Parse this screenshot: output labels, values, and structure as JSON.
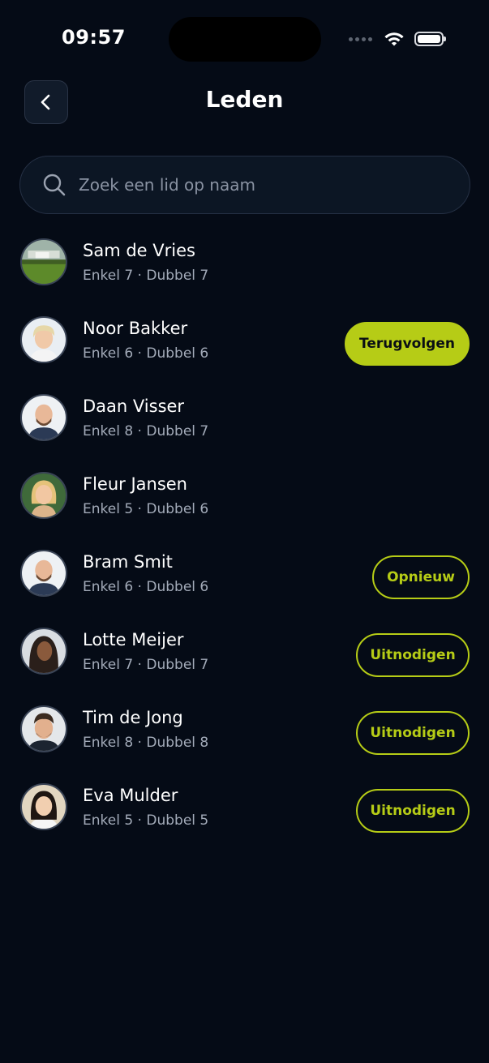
{
  "status_bar": {
    "time": "09:57"
  },
  "header": {
    "title": "Leden"
  },
  "search": {
    "placeholder": "Zoek een lid op naam"
  },
  "colors": {
    "background": "#050b16",
    "accent": "#b6cc16",
    "muted_text": "#a3abb9"
  },
  "members": [
    {
      "name": "Sam de Vries",
      "stats": "Enkel 7 · Dubbel 7",
      "avatar": "landscape-photo",
      "action": null
    },
    {
      "name": "Noor Bakker",
      "stats": "Enkel 6 · Dubbel 6",
      "avatar": "person-blonde-short-hair",
      "action": {
        "label": "Terugvolgen",
        "style": "filled"
      }
    },
    {
      "name": "Daan Visser",
      "stats": "Enkel 8 · Dubbel 7",
      "avatar": "person-bald-beard",
      "action": null
    },
    {
      "name": "Fleur Jansen",
      "stats": "Enkel 5 · Dubbel 6",
      "avatar": "person-blonde-long-hair",
      "action": null
    },
    {
      "name": "Bram Smit",
      "stats": "Enkel 6 · Dubbel 6",
      "avatar": "person-bald-beard",
      "action": {
        "label": "Opnieuw",
        "style": "outline"
      }
    },
    {
      "name": "Lotte Meijer",
      "stats": "Enkel 7 · Dubbel 7",
      "avatar": "person-dark-long-hair",
      "action": {
        "label": "Uitnodigen",
        "style": "outline"
      }
    },
    {
      "name": "Tim de Jong",
      "stats": "Enkel 8 · Dubbel 8",
      "avatar": "person-dark-short-hair",
      "action": {
        "label": "Uitnodigen",
        "style": "outline"
      }
    },
    {
      "name": "Eva Mulder",
      "stats": "Enkel 5 · Dubbel 5",
      "avatar": "person-dark-long-hair-light",
      "action": {
        "label": "Uitnodigen",
        "style": "outline"
      }
    }
  ]
}
